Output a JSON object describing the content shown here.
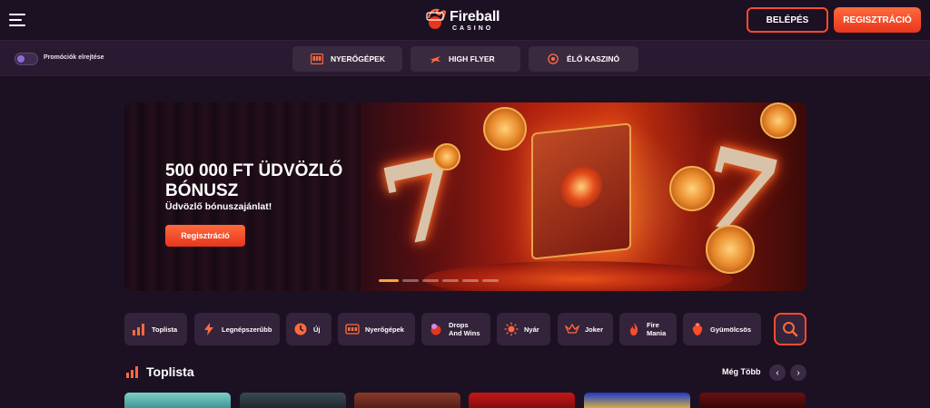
{
  "header": {
    "logo_title": "Fireball",
    "logo_sub": "CASINO",
    "login_label": "BELÉPÉS",
    "register_label": "REGISZTRÁCIÓ"
  },
  "subbar": {
    "toggle_label": "Promóciók elrejtése",
    "tabs": [
      {
        "label": "NYERŐGÉPEK",
        "icon": "slot-machine-icon"
      },
      {
        "label": "HIGH FLYER",
        "icon": "plane-icon"
      },
      {
        "label": "ÉLŐ KASZINÓ",
        "icon": "roulette-icon"
      }
    ]
  },
  "hero": {
    "title": "500 000 FT ÜDVÖZLŐ BÓNUSZ",
    "subtitle": "Üdvözlő bónuszajánlat!",
    "cta": "Regisztráció",
    "slides_total": 6,
    "slide_active": 1
  },
  "categories": [
    {
      "label": "Toplista",
      "icon": "chart-icon"
    },
    {
      "label": "Legnépszerűbb",
      "icon": "lightning-icon"
    },
    {
      "label": "Új",
      "icon": "clock-icon"
    },
    {
      "label": "Nyerőgépek",
      "icon": "slot-machine-icon"
    },
    {
      "label": "Drops And Wins",
      "line1": "Drops",
      "line2": "And Wins",
      "icon": "drops-icon"
    },
    {
      "label": "Nyár",
      "icon": "sun-icon"
    },
    {
      "label": "Joker",
      "icon": "jester-icon"
    },
    {
      "label": "Fire Mania",
      "line1": "Fire",
      "line2": "Mania",
      "icon": "flame-icon"
    },
    {
      "label": "Gyümölcsös",
      "icon": "strawberry-icon"
    }
  ],
  "toplist": {
    "title": "Toplista",
    "more_label": "Még Több",
    "prev": "‹",
    "next": "›"
  },
  "colors": {
    "accent": "#ff4b2b",
    "background": "#1c1023",
    "panel": "#33233b"
  }
}
